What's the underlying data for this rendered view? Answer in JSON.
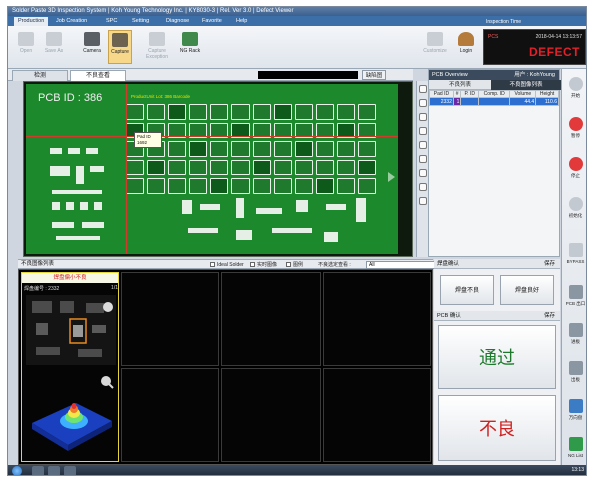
{
  "window": {
    "title": "Solder Paste 3D Inspection System | Koh Young Technology Inc. | KY8030-3 | Rel. Ver 3.0 | Defect Viewer"
  },
  "menu": [
    "Production",
    "Job Creation",
    "SPC",
    "Setting",
    "Diagnose",
    "Favorite",
    "Help"
  ],
  "toolbar": {
    "buttons": [
      {
        "label": "Open",
        "disabled": true
      },
      {
        "label": "Save As",
        "disabled": true
      },
      {
        "label": "Camera",
        "disabled": false
      },
      {
        "label": "Capture",
        "disabled": false,
        "selected": true
      },
      {
        "label": "Capture Exception",
        "disabled": true
      },
      {
        "label": "NG Rack",
        "disabled": false
      }
    ],
    "right_buttons": [
      {
        "label": "Customize",
        "disabled": true
      },
      {
        "label": "Login",
        "disabled": false
      }
    ]
  },
  "status": {
    "inspection_time_label": "Inspection Time",
    "pcs_label": "PCS",
    "time": "2018-04-14 13:13:57",
    "result": "DEFECT"
  },
  "view_tabs": [
    "检测",
    "不良查看"
  ],
  "view_buttons": [
    "缺陷图"
  ],
  "pcb": {
    "id_text": "PCB ID : 386",
    "hint_text": "ProductUnit Lot: 386 Barcode",
    "tooltip_line1": "Pad ID",
    "tooltip_line2": "1692"
  },
  "pad_panel": {
    "header": "PCB Overview",
    "user_label": "用户 : KohYoung",
    "subtabs": [
      "不良列表",
      "不良图像列表"
    ],
    "columns": [
      "Pad ID",
      "#",
      "P. ID",
      "Comp. ID",
      "Volume",
      "Height"
    ],
    "rows": [
      [
        "2332",
        "1",
        "",
        "",
        "44.4",
        "110.6"
      ]
    ]
  },
  "right_toolbar": [
    "开始",
    "暂停",
    "停止",
    "初始化",
    "BYPASS",
    "PCB 出口",
    "进板",
    "出板",
    "万向盘",
    "NG List"
  ],
  "defect_bar": {
    "title": "不良图像列表",
    "checks": [
      "Ideal Solder",
      "实时图像",
      "图例"
    ],
    "filter_label": "不良选定查看 :",
    "filter_value": "All"
  },
  "thumb": {
    "caption": "焊盘偏小不良",
    "name": "焊盘编号 : 2332",
    "page": "1/1"
  },
  "decide": {
    "pad_head": "焊盘确认",
    "pad_save": "保存",
    "btn_confirm": "焊盘不良",
    "btn_pass": "焊盘良好",
    "pcb_head": "PCB 确认",
    "pcb_save": "保存",
    "btn_ok": "通过",
    "btn_ng": "不良"
  },
  "taskbar": {
    "clock": "13:13"
  }
}
